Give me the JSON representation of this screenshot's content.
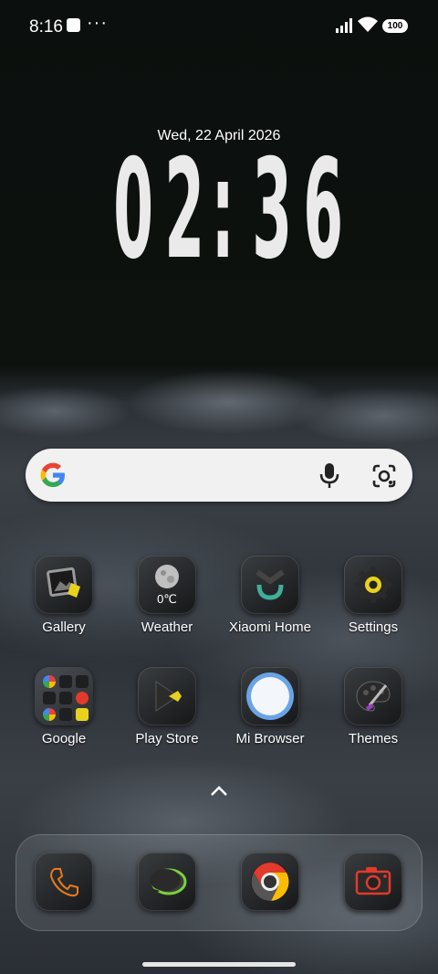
{
  "status_bar": {
    "time": "8:16",
    "battery": "100",
    "more": "···"
  },
  "lock": {
    "date": "Wed, 22 April 2026",
    "clock_h1": "0",
    "clock_h2": "2",
    "clock_sep": ":",
    "clock_m1": "3",
    "clock_m2": "6"
  },
  "search": {
    "icons": [
      "google-logo",
      "mic-icon",
      "google-lens-icon"
    ]
  },
  "apps_row1": [
    {
      "label": "Gallery",
      "icon": "gallery-icon"
    },
    {
      "label": "Weather",
      "icon": "weather-icon",
      "tile_text": "0℃"
    },
    {
      "label": "Xiaomi Home",
      "icon": "xiaomi-home-icon"
    },
    {
      "label": "Settings",
      "icon": "settings-icon"
    }
  ],
  "apps_row2": [
    {
      "label": "Google",
      "icon": "google-folder-icon"
    },
    {
      "label": "Play Store",
      "icon": "play-store-icon"
    },
    {
      "label": "Mi Browser",
      "icon": "mi-browser-icon"
    },
    {
      "label": "Themes",
      "icon": "themes-icon"
    }
  ],
  "dock": [
    {
      "icon": "phone-icon"
    },
    {
      "icon": "messages-icon"
    },
    {
      "icon": "chrome-icon"
    },
    {
      "icon": "camera-icon"
    }
  ],
  "colors": {
    "accent_yellow": "#e9d21e",
    "accent_green": "#3fae9a",
    "accent_red": "#e23a2c",
    "accent_blue": "#6aa3e6"
  }
}
